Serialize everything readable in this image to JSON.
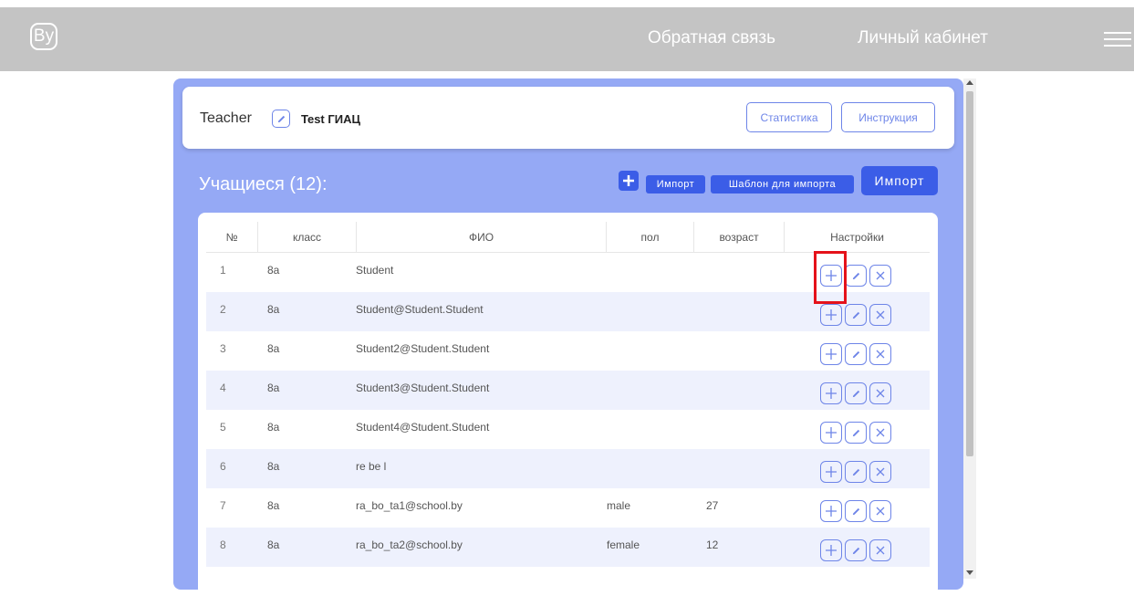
{
  "topbar": {
    "logo": "By",
    "nav_feedback": "Обратная связь",
    "nav_cabinet": "Личный кабинет"
  },
  "teacher": {
    "name": "Teacher",
    "school": "Test ГИАЦ",
    "stats_button": "Статистика",
    "guide_button": "Инструкция"
  },
  "students": {
    "title": "Учащиеся (12):",
    "add_icon": "plus-icon",
    "import_small": "Импорт",
    "template_button": "Шаблон для импорта",
    "import_button": "Импорт"
  },
  "table": {
    "headers": [
      "№",
      "класс",
      "ФИО",
      "пол",
      "возраст",
      "Настройки"
    ],
    "rows": [
      {
        "num": "1",
        "cls": "8а",
        "fio": "Student",
        "sex": "",
        "age": ""
      },
      {
        "num": "2",
        "cls": "8а",
        "fio": "Student@Student.Student",
        "sex": "",
        "age": ""
      },
      {
        "num": "3",
        "cls": "8а",
        "fio": "Student2@Student.Student",
        "sex": "",
        "age": ""
      },
      {
        "num": "4",
        "cls": "8а",
        "fio": "Student3@Student.Student",
        "sex": "",
        "age": ""
      },
      {
        "num": "5",
        "cls": "8а",
        "fio": "Student4@Student.Student",
        "sex": "",
        "age": ""
      },
      {
        "num": "6",
        "cls": "8а",
        "fio": "re be l",
        "sex": "",
        "age": ""
      },
      {
        "num": "7",
        "cls": "8а",
        "fio": "ra_bo_ta1@school.by",
        "sex": "male",
        "age": "27"
      },
      {
        "num": "8",
        "cls": "8а",
        "fio": "ra_bo_ta2@school.by",
        "sex": "female",
        "age": "12"
      }
    ]
  },
  "colors": {
    "accent": "#3b5de7",
    "panel": "#95a9f5",
    "highlight": "#e5121a"
  }
}
